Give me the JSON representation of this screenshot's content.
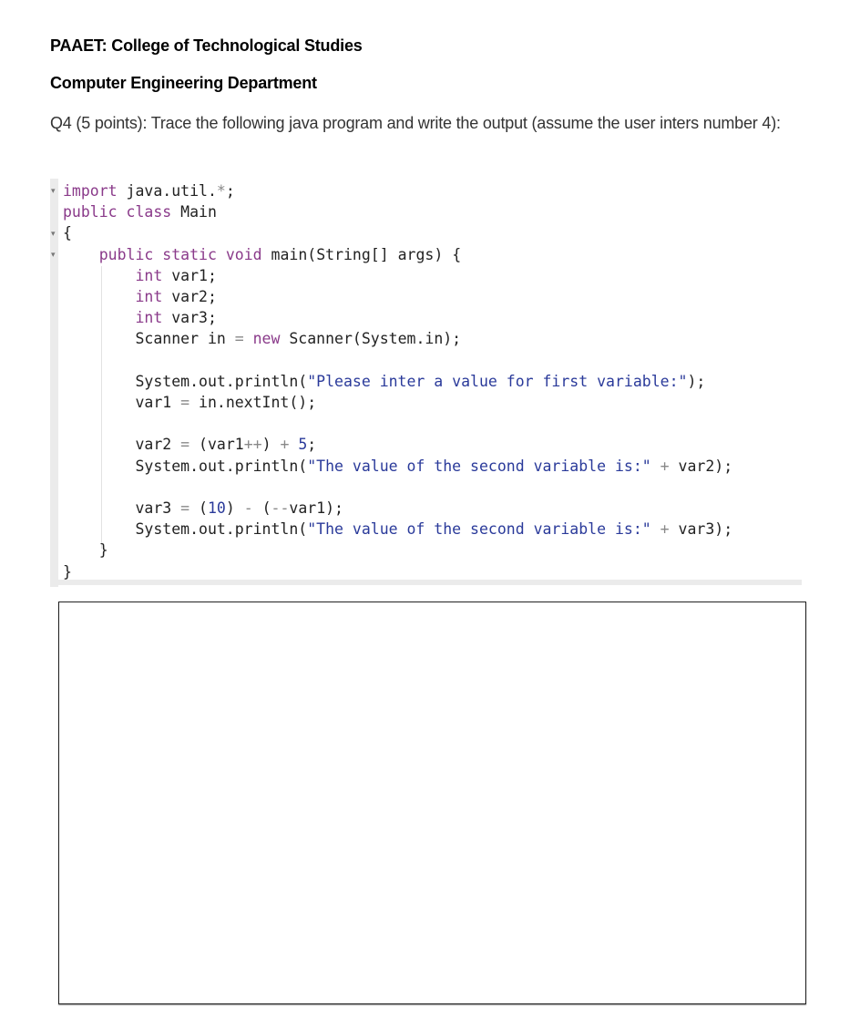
{
  "header": {
    "institution": "PAAET: College of Technological Studies",
    "department": "Computer Engineering Department"
  },
  "question": {
    "text": "Q4 (5 points): Trace the following java program and write the output (assume the user inters number 4):"
  },
  "code": {
    "language": "java",
    "lines": [
      "import java.util.*;",
      "public class Main",
      "{",
      "    public static void main(String[] args) {",
      "        int var1;",
      "        int var2;",
      "        int var3;",
      "        Scanner in = new Scanner(System.in);",
      "",
      "        System.out.println(\"Please inter a value for first variable:\");",
      "        var1 = in.nextInt();",
      "",
      "        var2 = (var1++) + 5;",
      "        System.out.println(\"The value of the second variable is:\" + var2);",
      "",
      "        var3 = (10) - (--var1);",
      "        System.out.println(\"The value of the second variable is:\" + var3);",
      "    }",
      "}"
    ],
    "colors": {
      "keyword": "#8a3a8a",
      "string": "#2a3a9a",
      "text": "#222222",
      "gutter": "#ebebeb"
    }
  },
  "answer_box": {
    "value": ""
  }
}
